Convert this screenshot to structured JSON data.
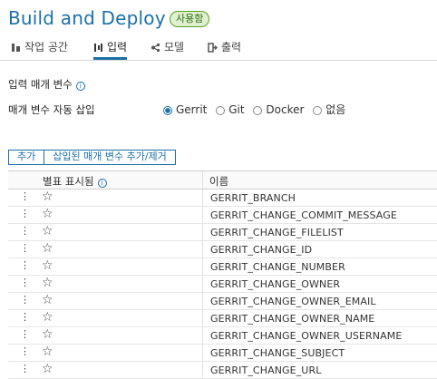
{
  "header": {
    "title": "Build and Deploy",
    "badge": "사용함"
  },
  "tabs": [
    {
      "label": "작업 공간",
      "icon": "workspace-icon",
      "active": false
    },
    {
      "label": "입력",
      "icon": "input-icon",
      "active": true
    },
    {
      "label": "모델",
      "icon": "model-icon",
      "active": false
    },
    {
      "label": "출력",
      "icon": "output-icon",
      "active": false
    }
  ],
  "input_section": {
    "label": "입력 매개 변수",
    "auto_insert_label": "매개 변수 자동 삽입",
    "options": [
      "Gerrit",
      "Git",
      "Docker",
      "없음"
    ],
    "selected": "Gerrit"
  },
  "actions": {
    "add": "추가",
    "add_remove": "삽입된 매개 변수 추가/제거"
  },
  "table": {
    "headers": {
      "starred": "별표 표시됨",
      "name": "이름"
    },
    "rows": [
      "GERRIT_BRANCH",
      "GERRIT_CHANGE_COMMIT_MESSAGE",
      "GERRIT_CHANGE_FILELIST",
      "GERRIT_CHANGE_ID",
      "GERRIT_CHANGE_NUMBER",
      "GERRIT_CHANGE_OWNER",
      "GERRIT_CHANGE_OWNER_EMAIL",
      "GERRIT_CHANGE_OWNER_NAME",
      "GERRIT_CHANGE_OWNER_USERNAME",
      "GERRIT_CHANGE_SUBJECT",
      "GERRIT_CHANGE_URL"
    ]
  },
  "colors": {
    "accent": "#1b6fa8",
    "badge_bg": "#dff0d0",
    "badge_border": "#5aa220"
  }
}
